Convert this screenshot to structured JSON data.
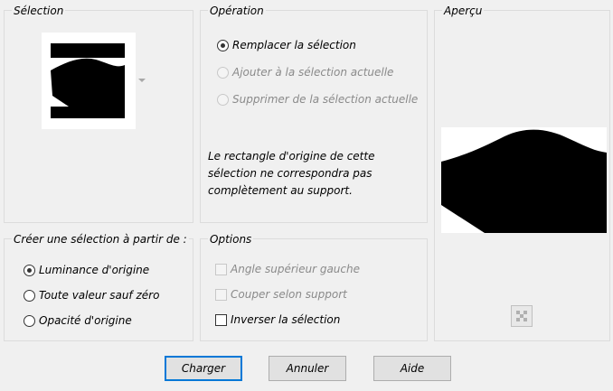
{
  "selection_group": {
    "title": "Sélection"
  },
  "operation_group": {
    "title": "Opération",
    "options": [
      {
        "label": "Remplacer la sélection",
        "checked": true,
        "enabled": true
      },
      {
        "label": "Ajouter à la sélection actuelle",
        "checked": false,
        "enabled": false
      },
      {
        "label": "Supprimer de la sélection actuelle",
        "checked": false,
        "enabled": false
      }
    ],
    "note": "Le rectangle d'origine de cette sélection ne correspondra pas complètement au support."
  },
  "preview_group": {
    "title": "Aperçu"
  },
  "create_from_group": {
    "title": "Créer une sélection à partir de :",
    "options": [
      {
        "label": "Luminance d'origine",
        "checked": true
      },
      {
        "label": "Toute valeur sauf zéro",
        "checked": false
      },
      {
        "label": "Opacité d'origine",
        "checked": false
      }
    ]
  },
  "options_group": {
    "title": "Options",
    "checks": [
      {
        "label": "Angle supérieur gauche",
        "checked": false,
        "enabled": false
      },
      {
        "label": "Couper selon support",
        "checked": false,
        "enabled": false
      },
      {
        "label": "Inverser la sélection",
        "checked": false,
        "enabled": true
      }
    ]
  },
  "buttons": {
    "load": "Charger",
    "cancel": "Annuler",
    "help": "Aide"
  },
  "icons": {
    "dropdown": "dropdown-arrow-icon",
    "checker": "checkerboard-icon"
  }
}
